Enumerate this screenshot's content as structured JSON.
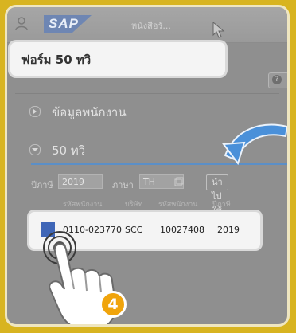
{
  "header": {
    "logo_text": "SAP",
    "title": "หนังสือรั..."
  },
  "form": {
    "title": "ฟอร์ม 50 ทวิ",
    "help_icon": "question-circle-icon"
  },
  "sections": [
    {
      "label": "ข้อมูลพนักงาน",
      "expanded": false
    },
    {
      "label": "50 ทวิ",
      "expanded": true
    }
  ],
  "filters": {
    "year_label": "ปีภาษี",
    "year_value": "2019",
    "language_label": "ภาษา",
    "language_value": "TH",
    "export_button": "นำไปใช้"
  },
  "table": {
    "columns": [
      "รหัสพนักงาน",
      "บริษัท",
      "รหัสพนักงาน",
      "ปีภาษี"
    ],
    "rows": [
      {
        "col1": "0110-023770",
        "col2": "SCC",
        "col3": "10027408",
        "col4": "2019"
      }
    ]
  },
  "tutorial": {
    "step_number": "4",
    "pointer_icon": "hand-pointer-icon",
    "arrow_icon": "curved-arrow-icon"
  },
  "colors": {
    "background": "#d8b420",
    "accent_blue": "#4a90d9",
    "step_badge": "#f0a40c",
    "row_marker": "#3f66b7"
  }
}
